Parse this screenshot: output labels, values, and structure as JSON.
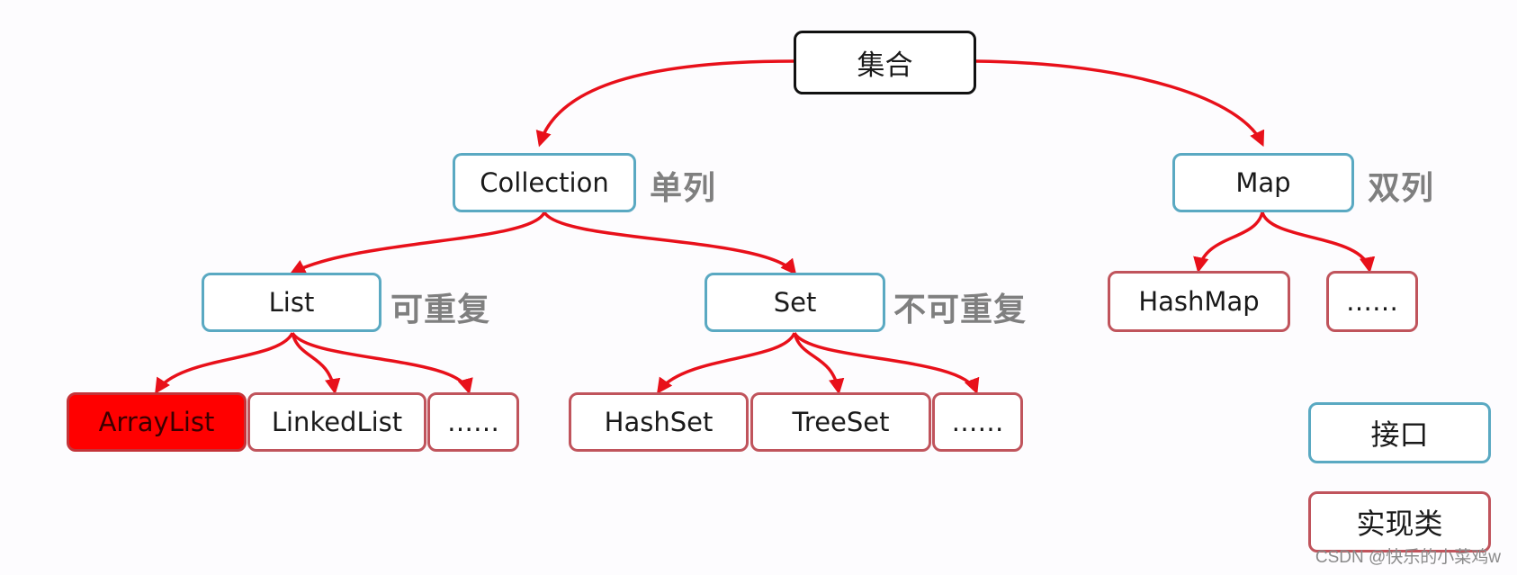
{
  "diagram": {
    "root": {
      "label": "集合"
    },
    "collection": {
      "label": "Collection",
      "annotation": "单列"
    },
    "map": {
      "label": "Map",
      "annotation": "双列"
    },
    "list": {
      "label": "List",
      "annotation": "可重复"
    },
    "set": {
      "label": "Set",
      "annotation": "不可重复"
    },
    "list_impls": [
      {
        "label": "ArrayList",
        "highlighted": true
      },
      {
        "label": "LinkedList"
      },
      {
        "label": "……"
      }
    ],
    "set_impls": [
      {
        "label": "HashSet"
      },
      {
        "label": "TreeSet"
      },
      {
        "label": "……"
      }
    ],
    "map_impls": [
      {
        "label": "HashMap"
      },
      {
        "label": "……"
      }
    ]
  },
  "legend": {
    "interface_label": "接口",
    "implementation_label": "实现类"
  },
  "colors": {
    "arrow": "#e8101a",
    "interface_border": "#5aa9c2",
    "implementation_border": "#c0545c",
    "root_border": "#111111",
    "highlight_fill": "#ff0000",
    "annotation_text": "#7f7f7f"
  },
  "watermark": "CSDN @快乐的小菜鸡w"
}
